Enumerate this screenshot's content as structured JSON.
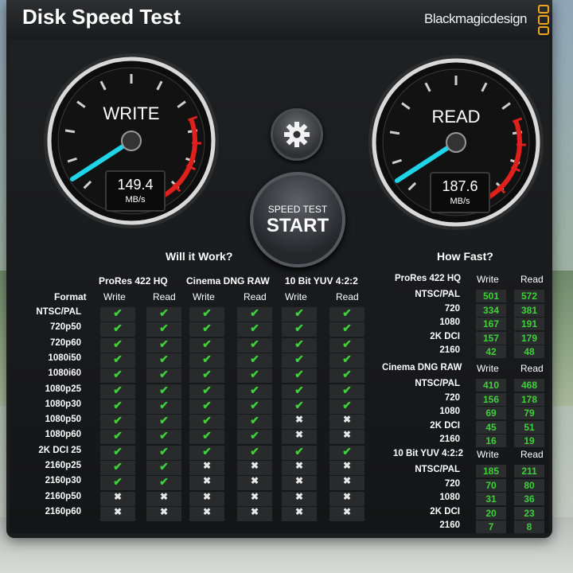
{
  "app": {
    "title": "Disk Speed Test",
    "brand": "Blackmagicdesign",
    "accent": "#f0a41f"
  },
  "gauges": {
    "write": {
      "title": "WRITE",
      "value": "149.4",
      "unit": "MB/s",
      "needle_color": "#1fd3e8",
      "redline_color": "#e0201c"
    },
    "read": {
      "title": "READ",
      "value": "187.6",
      "unit": "MB/s",
      "needle_color": "#1fd3e8",
      "redline_color": "#e0201c"
    }
  },
  "controls": {
    "settings_icon": "gear-icon",
    "start_top": "SPEED TEST",
    "start_bottom": "START"
  },
  "will_it_work": {
    "heading": "Will it Work?",
    "format_label": "Format",
    "groups": [
      {
        "name": "ProRes 422 HQ",
        "write": "Write",
        "read": "Read"
      },
      {
        "name": "Cinema DNG RAW",
        "write": "Write",
        "read": "Read"
      },
      {
        "name": "10 Bit YUV 4:2:2",
        "write": "Write",
        "read": "Read"
      }
    ],
    "formats": [
      "NTSC/PAL",
      "720p50",
      "720p60",
      "1080i50",
      "1080i60",
      "1080p25",
      "1080p30",
      "1080p50",
      "1080p60",
      "2K DCI 25",
      "2160p25",
      "2160p30",
      "2160p50",
      "2160p60"
    ],
    "results": [
      [
        1,
        1,
        1,
        1,
        1,
        1
      ],
      [
        1,
        1,
        1,
        1,
        1,
        1
      ],
      [
        1,
        1,
        1,
        1,
        1,
        1
      ],
      [
        1,
        1,
        1,
        1,
        1,
        1
      ],
      [
        1,
        1,
        1,
        1,
        1,
        1
      ],
      [
        1,
        1,
        1,
        1,
        1,
        1
      ],
      [
        1,
        1,
        1,
        1,
        1,
        1
      ],
      [
        1,
        1,
        1,
        1,
        0,
        0
      ],
      [
        1,
        1,
        1,
        1,
        0,
        0
      ],
      [
        1,
        1,
        1,
        1,
        1,
        1
      ],
      [
        1,
        1,
        0,
        0,
        0,
        0
      ],
      [
        1,
        1,
        0,
        0,
        0,
        0
      ],
      [
        0,
        0,
        0,
        0,
        0,
        0
      ],
      [
        0,
        0,
        0,
        0,
        0,
        0
      ]
    ],
    "ok_color": "#3ed13a"
  },
  "how_fast": {
    "heading": "How Fast?",
    "groups": [
      {
        "name": "ProRes 422 HQ",
        "write": "Write",
        "read": "Read",
        "rows": [
          {
            "label": "NTSC/PAL",
            "write": "501",
            "read": "572"
          },
          {
            "label": "720",
            "write": "334",
            "read": "381"
          },
          {
            "label": "1080",
            "write": "167",
            "read": "191"
          },
          {
            "label": "2K DCI",
            "write": "157",
            "read": "179"
          },
          {
            "label": "2160",
            "write": "42",
            "read": "48"
          }
        ]
      },
      {
        "name": "Cinema DNG RAW",
        "write": "Write",
        "read": "Read",
        "rows": [
          {
            "label": "NTSC/PAL",
            "write": "410",
            "read": "468"
          },
          {
            "label": "720",
            "write": "156",
            "read": "178"
          },
          {
            "label": "1080",
            "write": "69",
            "read": "79"
          },
          {
            "label": "2K DCI",
            "write": "45",
            "read": "51"
          },
          {
            "label": "2160",
            "write": "16",
            "read": "19"
          }
        ]
      },
      {
        "name": "10 Bit YUV 4:2:2",
        "write": "Write",
        "read": "Read",
        "rows": [
          {
            "label": "NTSC/PAL",
            "write": "185",
            "read": "211"
          },
          {
            "label": "720",
            "write": "70",
            "read": "80"
          },
          {
            "label": "1080",
            "write": "31",
            "read": "36"
          },
          {
            "label": "2K DCI",
            "write": "20",
            "read": "23"
          },
          {
            "label": "2160",
            "write": "7",
            "read": "8"
          }
        ]
      }
    ]
  }
}
